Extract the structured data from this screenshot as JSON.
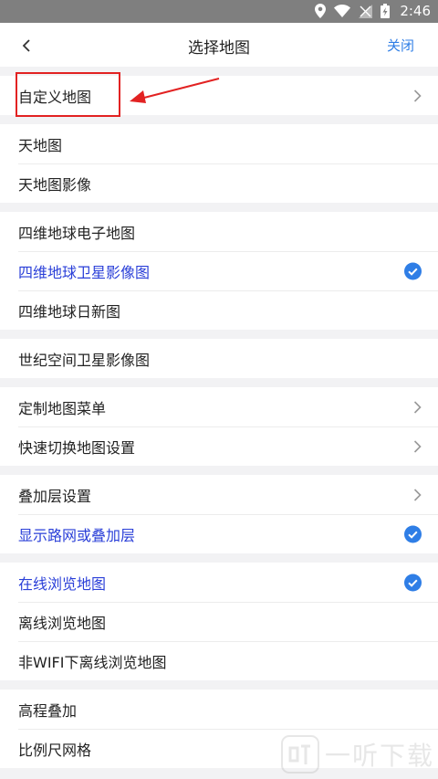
{
  "status": {
    "time": "2:46"
  },
  "header": {
    "title": "选择地图",
    "close_label": "关闭"
  },
  "sections": [
    {
      "items": [
        {
          "label": "自定义地图",
          "trail": "chevron"
        }
      ]
    },
    {
      "items": [
        {
          "label": "天地图"
        },
        {
          "label": "天地图影像"
        }
      ]
    },
    {
      "items": [
        {
          "label": "四维地球电子地图"
        },
        {
          "label": "四维地球卫星影像图",
          "active": true,
          "trail": "check"
        },
        {
          "label": "四维地球日新图"
        }
      ]
    },
    {
      "items": [
        {
          "label": "世纪空间卫星影像图"
        }
      ]
    },
    {
      "items": [
        {
          "label": "定制地图菜单",
          "trail": "chevron"
        },
        {
          "label": "快速切换地图设置",
          "trail": "chevron"
        }
      ]
    },
    {
      "items": [
        {
          "label": "叠加层设置",
          "trail": "chevron"
        },
        {
          "label": "显示路网或叠加层",
          "active": true,
          "trail": "check"
        }
      ]
    },
    {
      "items": [
        {
          "label": "在线浏览地图",
          "active": true,
          "trail": "check"
        },
        {
          "label": "离线浏览地图"
        },
        {
          "label": "非WIFI下离线浏览地图"
        }
      ]
    },
    {
      "items": [
        {
          "label": "高程叠加"
        },
        {
          "label": "比例尺网格"
        }
      ]
    }
  ],
  "watermark": {
    "text": "一听下载"
  },
  "colors": {
    "accent": "#2f7ee6",
    "active_text": "#2a3fd8",
    "annotation": "#e22222"
  }
}
